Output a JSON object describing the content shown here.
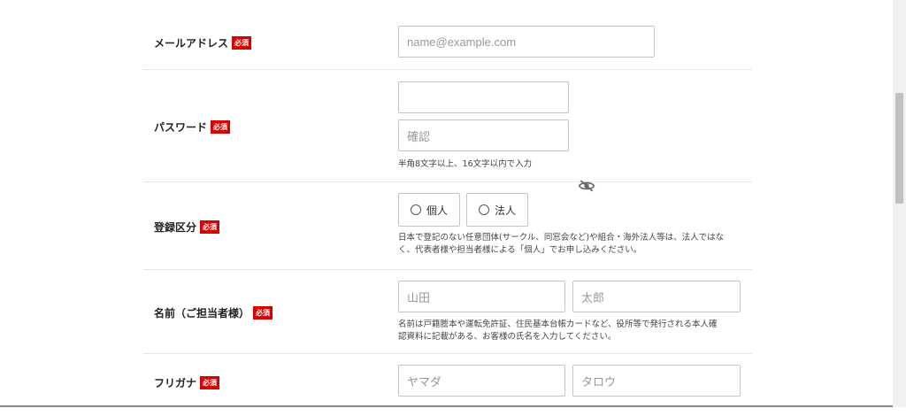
{
  "required_badge": "必須",
  "email": {
    "label": "メールアドレス",
    "placeholder": "name@example.com"
  },
  "password": {
    "label": "パスワード",
    "placeholder": "",
    "confirm_placeholder": "確認",
    "help": "半角8文字以上、16文字以内で入力",
    "toggle_icon": "eye-slash-icon"
  },
  "registration_type": {
    "label": "登録区分",
    "options": [
      "個人",
      "法人"
    ],
    "help_lines": [
      "日本で登記のない任意団体(サークル、同窓会など)や組合・海外法人等は、法人ではな",
      "く、代表者様や担当者様による「個人」でお申し込みください。"
    ]
  },
  "name": {
    "label": "名前（ご担当者様）",
    "last_placeholder": "山田",
    "first_placeholder": "太郎",
    "help_lines": [
      "名前は戸籍謄本や運転免許証、住民基本台帳カードなど、役所等で発行される本人確",
      "認資料に記載がある、お客様の氏名を入力してください。"
    ]
  },
  "furigana": {
    "label": "フリガナ",
    "last_placeholder": "ヤマダ",
    "first_placeholder": "タロウ"
  }
}
